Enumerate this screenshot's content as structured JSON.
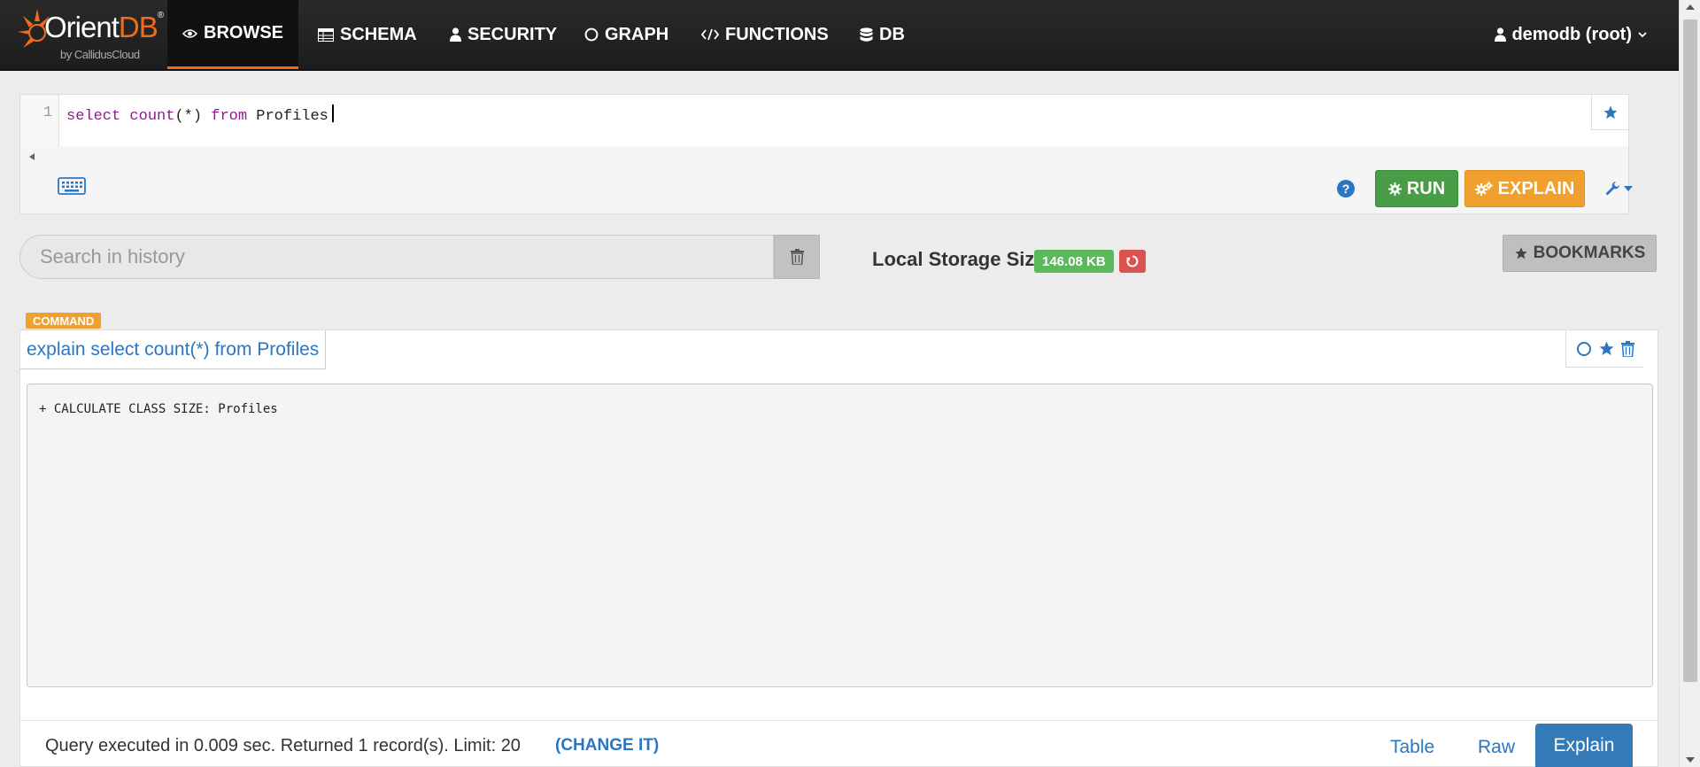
{
  "app": {
    "logo_text": "OrientDB",
    "logo_tm": "®",
    "logo_sub": "by CallidusCloud"
  },
  "nav": {
    "items": [
      {
        "label": "BROWSE",
        "icon": "eye-icon",
        "active": true
      },
      {
        "label": "SCHEMA",
        "icon": "table-icon",
        "active": false
      },
      {
        "label": "SECURITY",
        "icon": "user-icon",
        "active": false
      },
      {
        "label": "GRAPH",
        "icon": "circle-icon",
        "active": false
      },
      {
        "label": "FUNCTIONS",
        "icon": "code-icon",
        "active": false
      },
      {
        "label": "DB",
        "icon": "database-icon",
        "active": false
      }
    ],
    "user": "demodb (root)"
  },
  "editor": {
    "line_number": "1",
    "code": {
      "kw_select": "select",
      "fn_count": "count",
      "args": "(*)",
      "kw_from": "from",
      "target": "Profiles"
    },
    "run_label": "RUN",
    "explain_label": "EXPLAIN"
  },
  "history": {
    "search_placeholder": "Search in history",
    "storage_label": "Local Storage Size",
    "storage_size": "146.08 KB",
    "bookmarks_label": "BOOKMARKS"
  },
  "result": {
    "badge": "COMMAND",
    "query": "explain select count(*) from Profiles",
    "plan_output": "+ CALCULATE CLASS SIZE: Profiles",
    "status": "Query executed in 0.009 sec. Returned 1 record(s). Limit: 20",
    "change_link": "(CHANGE IT)",
    "views": {
      "table": "Table",
      "raw": "Raw",
      "explain": "Explain"
    }
  },
  "colors": {
    "accent_orange": "#f26b1d",
    "run_green": "#4a9d47",
    "explain_orange": "#f0a02e",
    "link_blue": "#2b76c2",
    "badge_green": "#5cb85c",
    "danger_red": "#d9534f"
  }
}
